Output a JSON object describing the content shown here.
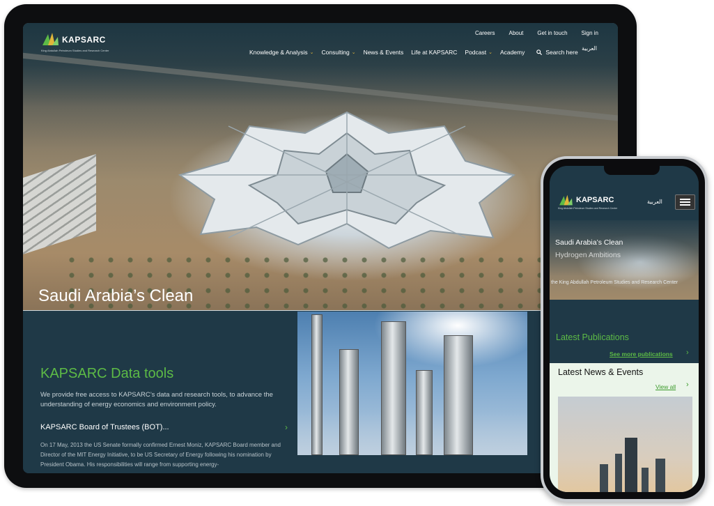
{
  "tablet": {
    "logo": {
      "name": "KAPSARC",
      "subtitle": "King Abdullah Petroleum Studies and Research Center"
    },
    "top_nav": [
      "Careers",
      "About",
      "Get in touch",
      "Sign in"
    ],
    "main_nav": [
      {
        "label": "Knowledge & Analysis",
        "dropdown": true
      },
      {
        "label": "Consulting",
        "dropdown": true
      },
      {
        "label": "News & Events",
        "dropdown": false
      },
      {
        "label": "Life at KAPSARC",
        "dropdown": false
      },
      {
        "label": "Podcast",
        "dropdown": true
      },
      {
        "label": "Academy",
        "dropdown": false
      }
    ],
    "search_label": "Search here",
    "arabic_label": "العربية",
    "hero_caption": "Saudi Arabia’s Clean",
    "data_tools": {
      "title": "KAPSARC Data tools",
      "description": "We provide free access to KAPSARC’s data and research tools, to advance the understanding of energy economics and environment policy."
    },
    "board_link": "KAPSARC Board of Trustees (BOT)...",
    "news_excerpt": "On 17 May, 2013 the US Senate formally confirmed Ernest Moniz, KAPSARC Board member and Director of the MIT Energy Initiative, to be US Secretary of Energy following his nomination by President Obama. His responsibilities will range from supporting energy-"
  },
  "phone": {
    "logo": {
      "name": "KAPSARC",
      "subtitle": "King Abdullah Petroleum Studies and Research Center"
    },
    "arabic_label": "العربية",
    "hero_title_1": "Saudi Arabia’s Clean",
    "hero_title_2": "Hydrogen Ambitions",
    "hero_caption": "the King Abdullah Petroleum Studies and Research Center",
    "publications": {
      "title": "Latest Publications",
      "link": "See more publications"
    },
    "news": {
      "title": "Latest News & Events",
      "link": "View all"
    }
  },
  "colors": {
    "brand_green": "#5dbb46",
    "navy": "#1f3947",
    "nav_chevron": "#e0b63a",
    "news_bg": "#ebf5ea"
  },
  "icons": [
    "kapsarc-logo-icon",
    "chevron-down-icon",
    "search-icon",
    "chevron-right-icon",
    "hamburger-menu-icon"
  ]
}
